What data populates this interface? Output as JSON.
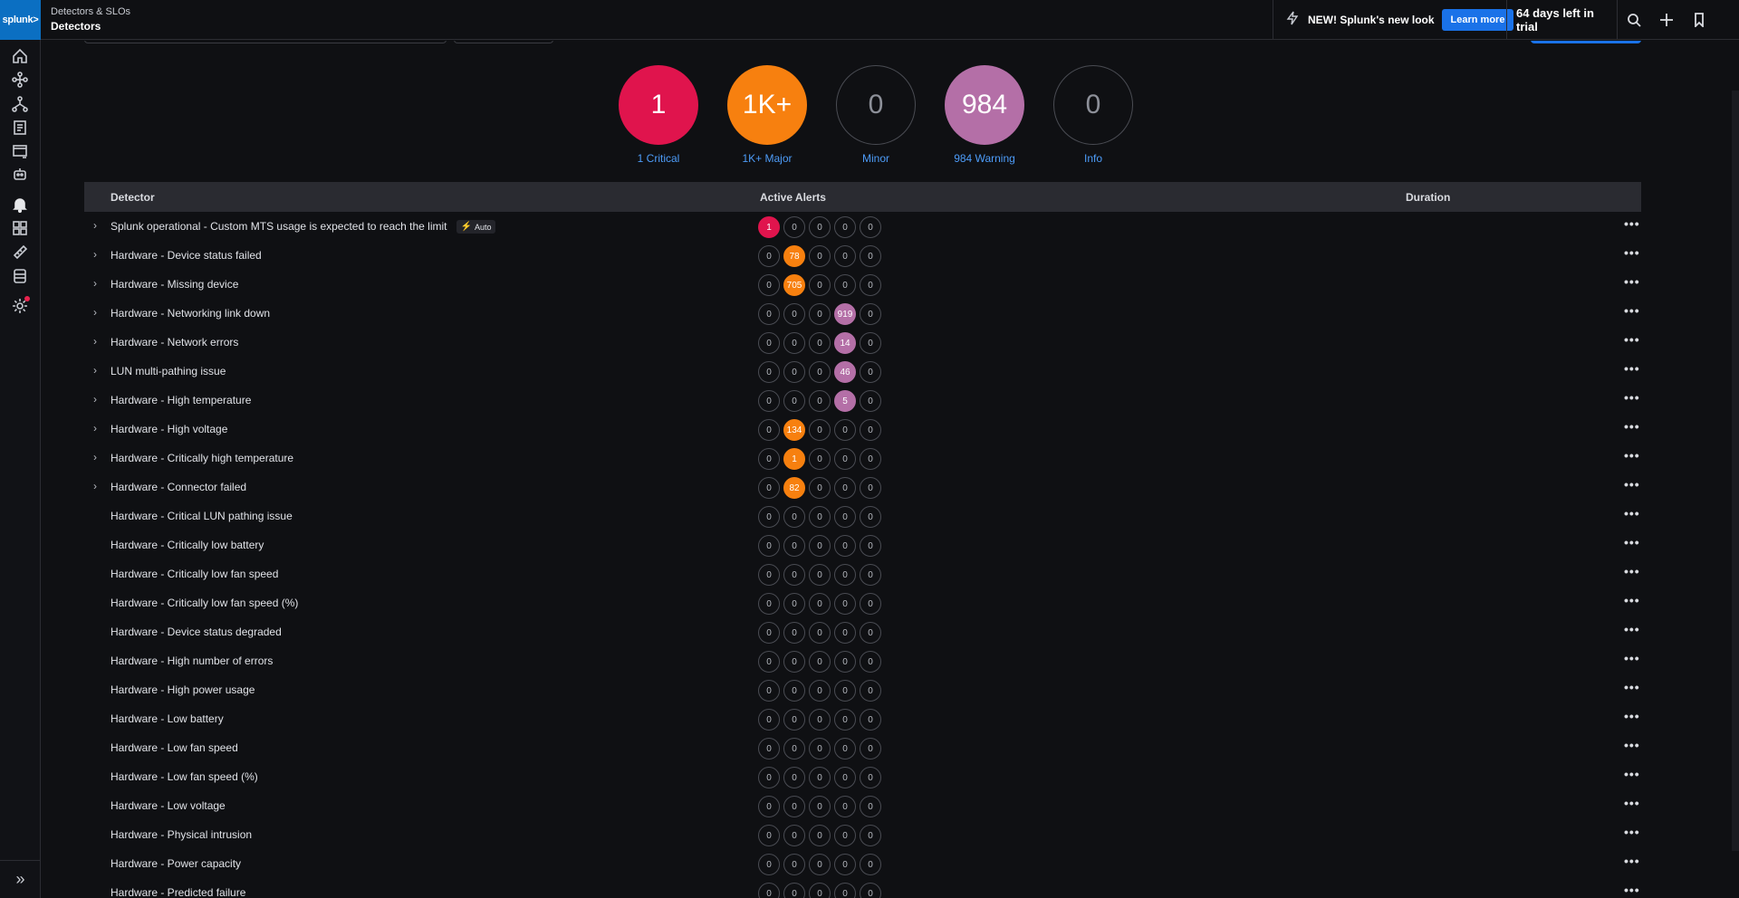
{
  "app": {
    "logo_text": "splunk>"
  },
  "breadcrumb": {
    "parent": "Detectors & SLOs",
    "current": "Detectors"
  },
  "topbar": {
    "promo_text": "NEW! Splunk's new look",
    "learn_more_label": "Learn more",
    "trial_text": "64 days left in trial",
    "icons": [
      "bolt-icon",
      "search-icon",
      "plus-icon",
      "bookmark-icon"
    ]
  },
  "leftnav": {
    "icons": [
      "home-icon",
      "infrastructure-icon",
      "apm-icon",
      "logs-icon",
      "rum-icon",
      "synthetics-icon",
      "alerts-bell-icon",
      "dashboards-icon",
      "slo-icon",
      "data-management-icon",
      "settings-icon"
    ],
    "active": "alerts-bell-icon",
    "settings_has_notification": true,
    "expand_label": "»"
  },
  "summary": [
    {
      "key": "critical",
      "value": "1",
      "label": "1 Critical",
      "color": "#e0144d",
      "filled": true
    },
    {
      "key": "major",
      "value": "1K+",
      "label": "1K+ Major",
      "color": "#f7800f",
      "filled": true
    },
    {
      "key": "minor",
      "value": "0",
      "label": "Minor",
      "color": "",
      "filled": false
    },
    {
      "key": "warning",
      "value": "984",
      "label": "984 Warning",
      "color": "#b46fa7",
      "filled": true
    },
    {
      "key": "info",
      "value": "0",
      "label": "Info",
      "color": "",
      "filled": false
    }
  ],
  "table": {
    "columns": {
      "detector": "Detector",
      "active_alerts": "Active Alerts",
      "duration": "Duration"
    },
    "rows": [
      {
        "name": "Splunk operational - Custom MTS usage is expected to reach the limit",
        "expandable": true,
        "badge": "Auto",
        "alerts": [
          "1",
          "0",
          "0",
          "0",
          "0"
        ]
      },
      {
        "name": "Hardware - Device status failed",
        "expandable": true,
        "alerts": [
          "0",
          "78",
          "0",
          "0",
          "0"
        ]
      },
      {
        "name": "Hardware - Missing device",
        "expandable": true,
        "alerts": [
          "0",
          "705",
          "0",
          "0",
          "0"
        ]
      },
      {
        "name": "Hardware - Networking link down",
        "expandable": true,
        "alerts": [
          "0",
          "0",
          "0",
          "919",
          "0"
        ]
      },
      {
        "name": "Hardware - Network errors",
        "expandable": true,
        "alerts": [
          "0",
          "0",
          "0",
          "14",
          "0"
        ]
      },
      {
        "name": "LUN multi-pathing issue",
        "expandable": true,
        "alerts": [
          "0",
          "0",
          "0",
          "46",
          "0"
        ]
      },
      {
        "name": "Hardware - High temperature",
        "expandable": true,
        "alerts": [
          "0",
          "0",
          "0",
          "5",
          "0"
        ]
      },
      {
        "name": "Hardware - High voltage",
        "expandable": true,
        "alerts": [
          "0",
          "134",
          "0",
          "0",
          "0"
        ]
      },
      {
        "name": "Hardware - Critically high temperature",
        "expandable": true,
        "alerts": [
          "0",
          "1",
          "0",
          "0",
          "0"
        ]
      },
      {
        "name": "Hardware - Connector failed",
        "expandable": true,
        "alerts": [
          "0",
          "82",
          "0",
          "0",
          "0"
        ]
      },
      {
        "name": "Hardware - Critical LUN pathing issue",
        "expandable": false,
        "alerts": [
          "0",
          "0",
          "0",
          "0",
          "0"
        ]
      },
      {
        "name": "Hardware - Critically low battery",
        "expandable": false,
        "alerts": [
          "0",
          "0",
          "0",
          "0",
          "0"
        ]
      },
      {
        "name": "Hardware - Critically low fan speed",
        "expandable": false,
        "alerts": [
          "0",
          "0",
          "0",
          "0",
          "0"
        ]
      },
      {
        "name": "Hardware - Critically low fan speed (%)",
        "expandable": false,
        "alerts": [
          "0",
          "0",
          "0",
          "0",
          "0"
        ]
      },
      {
        "name": "Hardware - Device status degraded",
        "expandable": false,
        "alerts": [
          "0",
          "0",
          "0",
          "0",
          "0"
        ]
      },
      {
        "name": "Hardware - High number of errors",
        "expandable": false,
        "alerts": [
          "0",
          "0",
          "0",
          "0",
          "0"
        ]
      },
      {
        "name": "Hardware - High power usage",
        "expandable": false,
        "alerts": [
          "0",
          "0",
          "0",
          "0",
          "0"
        ]
      },
      {
        "name": "Hardware - Low battery",
        "expandable": false,
        "alerts": [
          "0",
          "0",
          "0",
          "0",
          "0"
        ]
      },
      {
        "name": "Hardware - Low fan speed",
        "expandable": false,
        "alerts": [
          "0",
          "0",
          "0",
          "0",
          "0"
        ]
      },
      {
        "name": "Hardware - Low fan speed (%)",
        "expandable": false,
        "alerts": [
          "0",
          "0",
          "0",
          "0",
          "0"
        ]
      },
      {
        "name": "Hardware - Low voltage",
        "expandable": false,
        "alerts": [
          "0",
          "0",
          "0",
          "0",
          "0"
        ]
      },
      {
        "name": "Hardware - Physical intrusion",
        "expandable": false,
        "alerts": [
          "0",
          "0",
          "0",
          "0",
          "0"
        ]
      },
      {
        "name": "Hardware - Power capacity",
        "expandable": false,
        "alerts": [
          "0",
          "0",
          "0",
          "0",
          "0"
        ]
      },
      {
        "name": "Hardware - Predicted failure",
        "expandable": false,
        "alerts": [
          "0",
          "0",
          "0",
          "0",
          "0"
        ]
      }
    ]
  }
}
